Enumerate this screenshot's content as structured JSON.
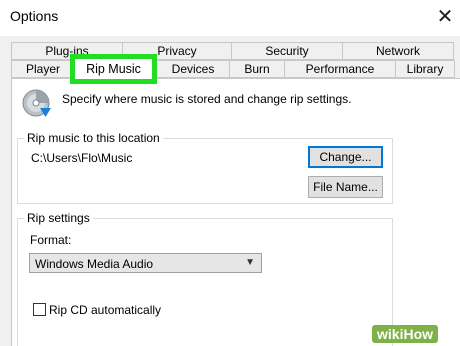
{
  "window": {
    "title": "Options"
  },
  "tabs": {
    "row1": [
      "Plug-ins",
      "Privacy",
      "Security",
      "Network"
    ],
    "row2": [
      "Player",
      "Rip Music",
      "Devices",
      "Burn",
      "Performance",
      "Library"
    ],
    "selected": "Rip Music"
  },
  "header": {
    "description": "Specify where music is stored and change rip settings."
  },
  "location": {
    "group_label": "Rip music to this location",
    "path": "C:\\Users\\Flo\\Music",
    "change_label": "Change...",
    "filename_label": "File Name..."
  },
  "rip_settings": {
    "group_label": "Rip settings",
    "format_label": "Format:",
    "format_value": "Windows Media Audio",
    "rip_cd_label": "Rip CD automatically",
    "rip_cd_checked": false
  },
  "watermark": {
    "text": "wikiHow"
  },
  "colors": {
    "highlight": "#22dd22",
    "focus": "#0078d7"
  }
}
